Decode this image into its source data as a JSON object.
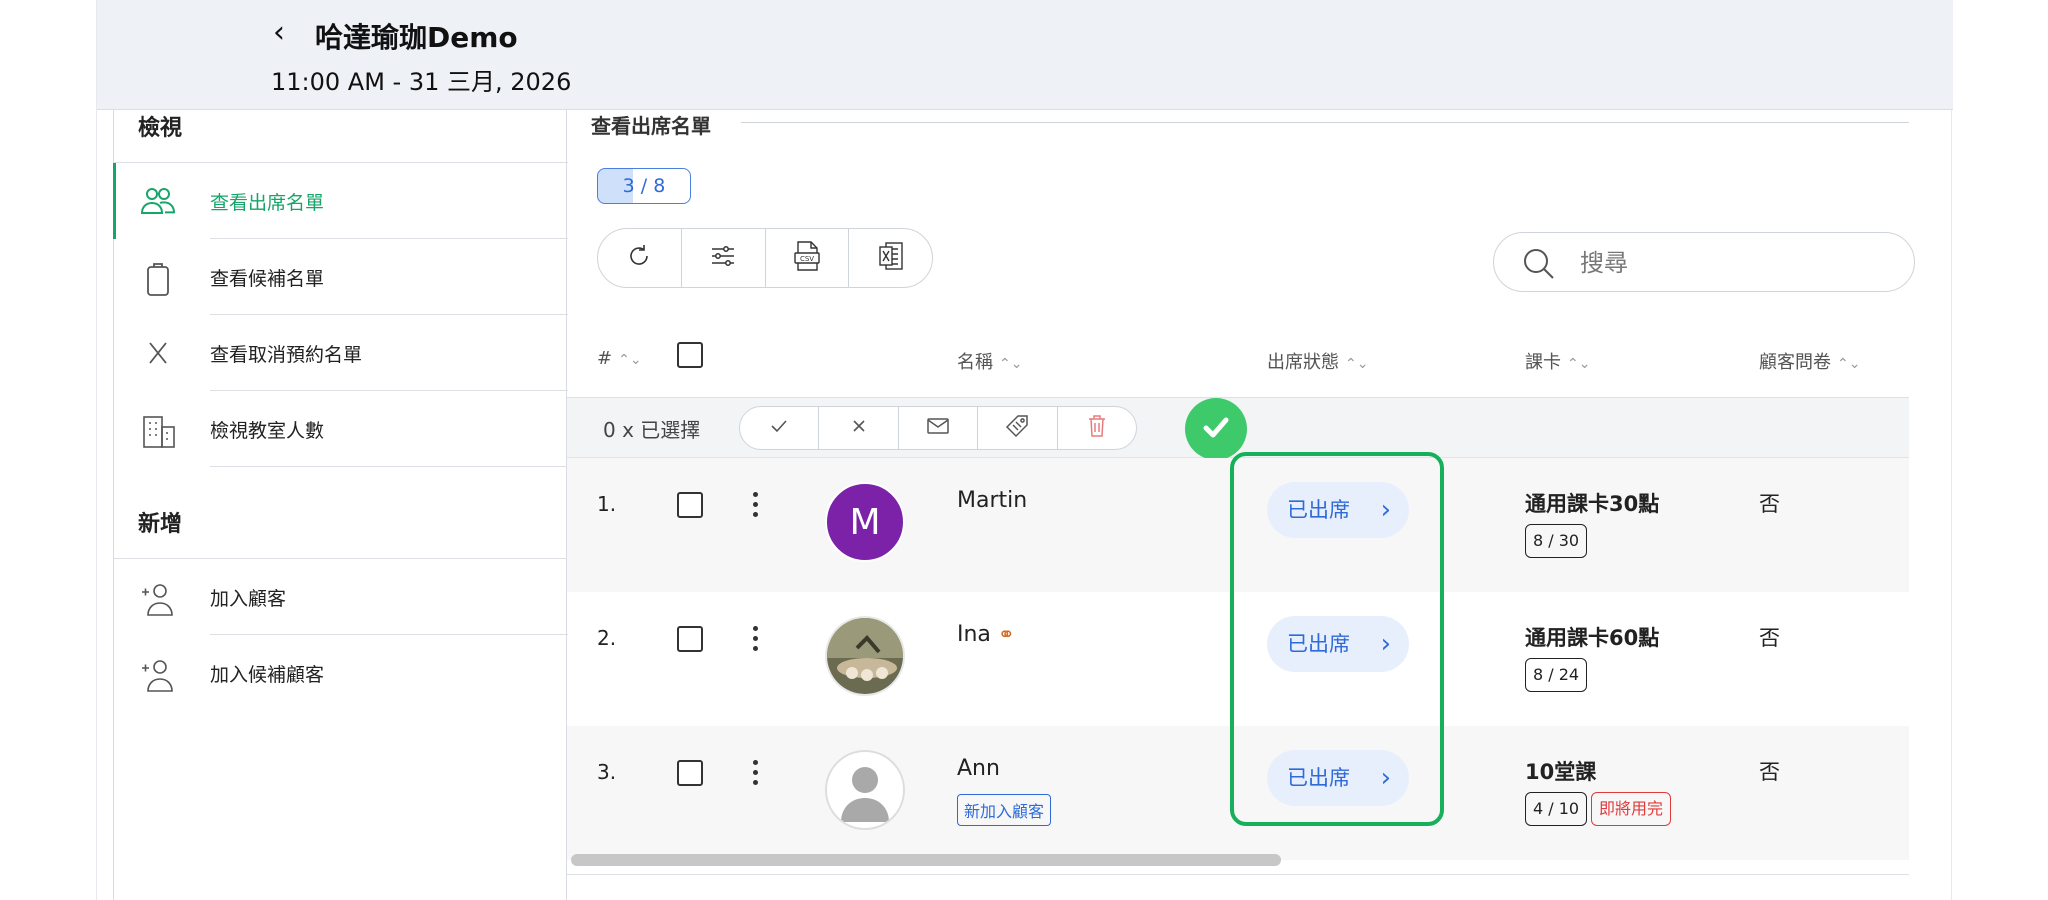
{
  "header": {
    "title": "哈達瑜珈Demo",
    "subtitle": "11:00 AM - 31 三月, 2026"
  },
  "sidebar": {
    "view_heading": "檢視",
    "add_heading": "新增",
    "view_items": [
      {
        "label": "查看出席名單",
        "icon": "users-icon",
        "active": true
      },
      {
        "label": "查看候補名單",
        "icon": "clipboard-icon",
        "active": false
      },
      {
        "label": "查看取消預約名單",
        "icon": "close-icon",
        "active": false
      },
      {
        "label": "檢視教室人數",
        "icon": "building-icon",
        "active": false
      }
    ],
    "add_items": [
      {
        "label": "加入顧客",
        "icon": "add-user-icon"
      },
      {
        "label": "加入候補顧客",
        "icon": "add-user-icon"
      }
    ]
  },
  "main": {
    "section_title": "查看出席名單",
    "count_badge": "3 / 8",
    "count_progress": 0.375,
    "search_placeholder": "搜尋",
    "columns": {
      "num": "#",
      "name": "名稱",
      "status": "出席狀態",
      "card": "課卡",
      "survey": "顧客問卷"
    },
    "selection_text": "0 x 已選擇",
    "rows": [
      {
        "num": "1.",
        "name": "Martin",
        "avatar_letter": "M",
        "avatar_color": "#7b22a8",
        "status": "已出席",
        "card": "通用課卡30點",
        "usage": "8 / 30",
        "survey": "否"
      },
      {
        "num": "2.",
        "name": "Ina",
        "status": "已出席",
        "card": "通用課卡60點",
        "usage": "8 / 24",
        "survey": "否"
      },
      {
        "num": "3.",
        "name": "Ann",
        "new_tag": "新加入顧客",
        "status": "已出席",
        "card": "10堂課",
        "usage": "4 / 10",
        "warning": "即將用完",
        "survey": "否"
      }
    ]
  },
  "colors": {
    "accent_green": "#17a56a",
    "link_blue": "#2f6bd8",
    "highlight_green": "#16b05a",
    "warning_red": "#e03a3a"
  }
}
